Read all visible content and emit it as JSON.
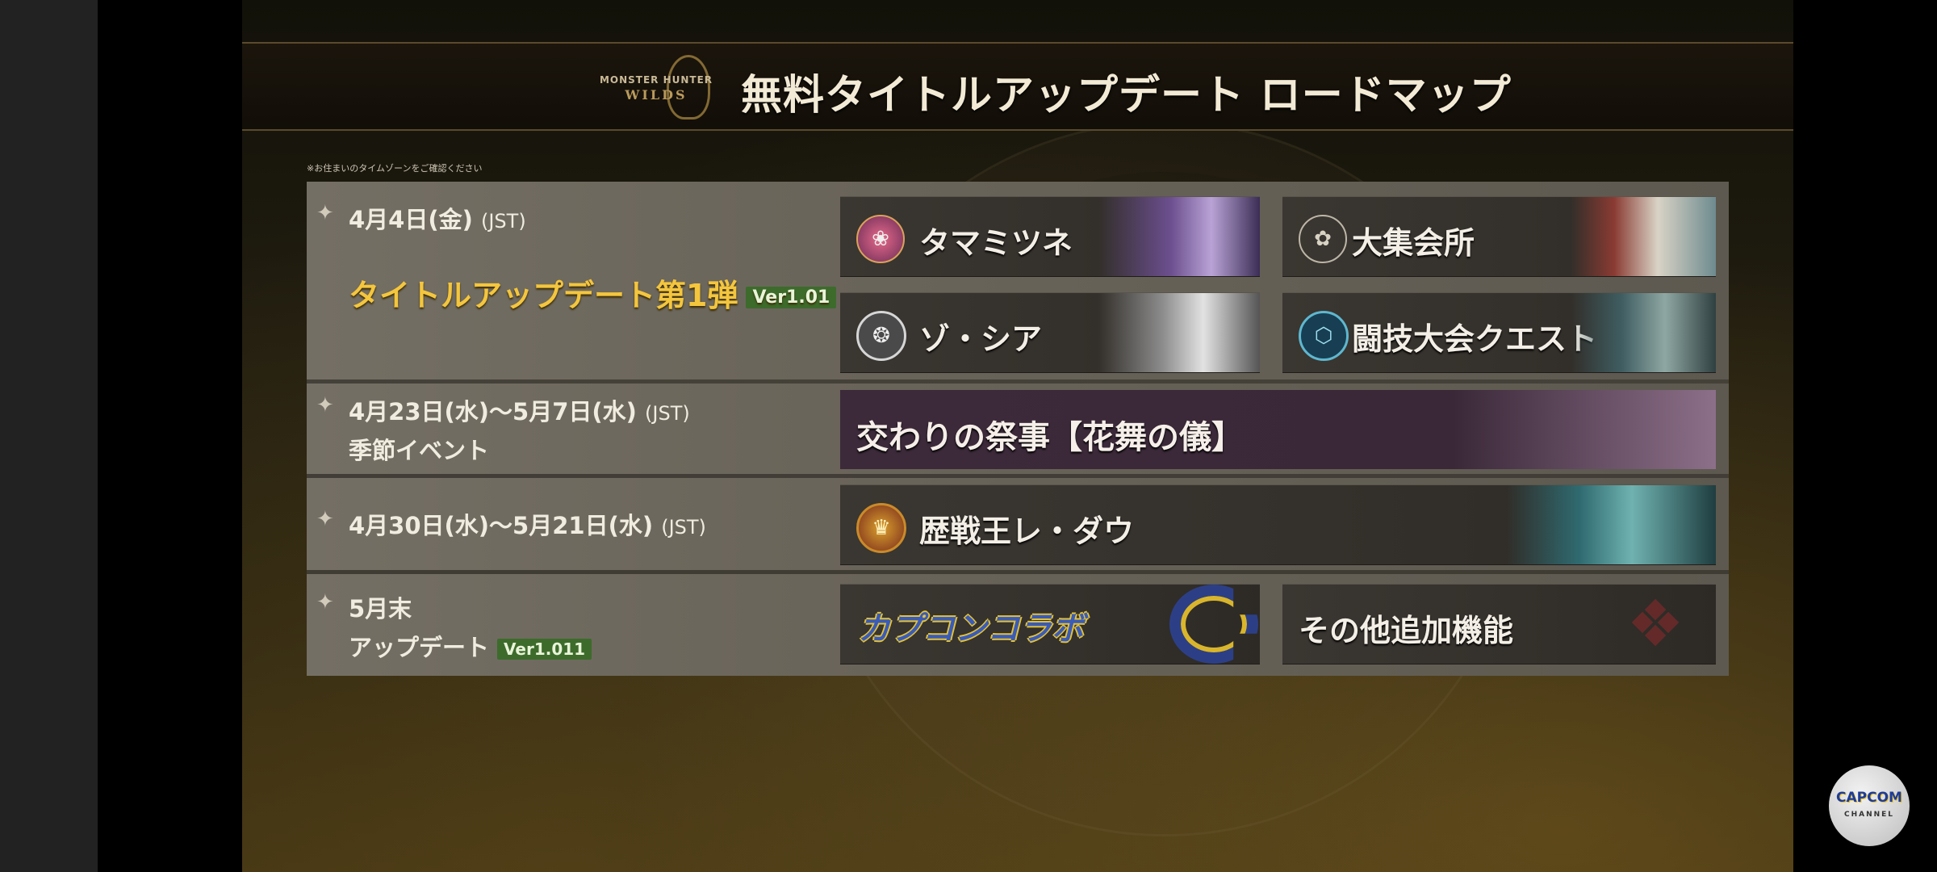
{
  "header": {
    "logo_line1": "MONSTER HUNTER",
    "logo_line2": "WILDS",
    "title": "無料タイトルアップデート ロードマップ"
  },
  "timezone_note": "※お住まいのタイムゾーンをご確認ください",
  "rows": [
    {
      "date": "4月4日(金)",
      "jst": "(JST)",
      "headline": "タイトルアップデート第1弾",
      "version": "Ver1.01",
      "cards": [
        {
          "label": "タマミツネ",
          "icon": "tamamitsune-icon"
        },
        {
          "label": "大集会所",
          "icon": "grand-hub-icon"
        },
        {
          "label": "ゾ・シア",
          "icon": "zoh-shia-icon"
        },
        {
          "label": "闘技大会クエスト",
          "icon": "arena-quest-icon"
        }
      ]
    },
    {
      "date": "4月23日(水)～5月7日(水)",
      "jst": "(JST)",
      "sub": "季節イベント",
      "cards": [
        {
          "label": "交わりの祭事【花舞の儀】"
        }
      ]
    },
    {
      "date": "4月30日(水)～5月21日(水)",
      "jst": "(JST)",
      "cards": [
        {
          "label": "歴戦王レ・ダウ",
          "icon": "rey-dau-icon"
        }
      ]
    },
    {
      "date": "5月末",
      "sub": "アップデート",
      "version": "Ver1.011",
      "cards": [
        {
          "label": "カプコンコラボ",
          "icon": "capcom-c-logo"
        },
        {
          "label": "その他追加機能",
          "icon": "emblem-icon"
        }
      ]
    }
  ],
  "channel_badge": {
    "line1": "CAPCOM",
    "line2": "CHANNEL"
  },
  "colors": {
    "gold_title": "#f4c63e",
    "version_badge": "#3d6b2c",
    "festival_card": "#3c2a3a"
  }
}
